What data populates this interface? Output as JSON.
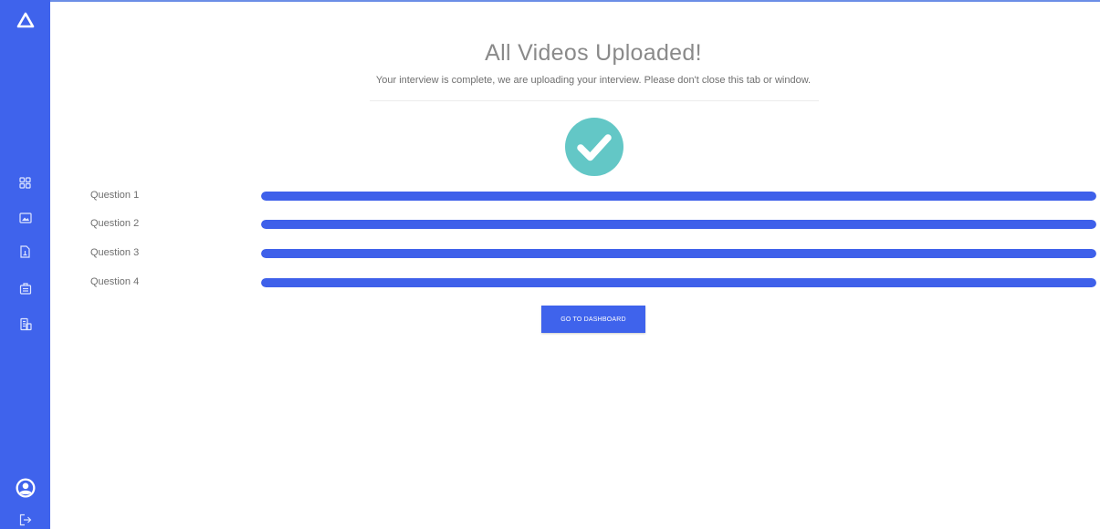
{
  "header": {
    "title": "All Videos Uploaded!",
    "subtitle": "Your interview is complete, we are uploading your interview. Please don't close this tab or window."
  },
  "status_icon": "check-circle-icon",
  "questions": [
    {
      "label": "Question 1",
      "progress": 1.0
    },
    {
      "label": "Question 2",
      "progress": 1.0
    },
    {
      "label": "Question 3",
      "progress": 1.0
    },
    {
      "label": "Question 4",
      "progress": 1.0
    }
  ],
  "actions": {
    "dashboard_label": "GO TO DASHBOARD"
  },
  "sidebar": {
    "logo": "triangle-logo",
    "items": [
      "dashboard-grid-icon",
      "image-icon",
      "document-icon",
      "briefcase-icon",
      "building-icon"
    ],
    "footer": [
      "user-avatar-icon",
      "logout-icon"
    ]
  },
  "colors": {
    "sidebar": "#3f63ec",
    "progress": "#3e60ea",
    "check": "#63c7c6",
    "button": "#3f63ec"
  }
}
